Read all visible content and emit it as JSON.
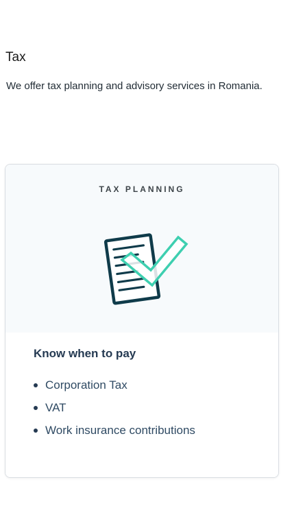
{
  "section": {
    "title": "Tax",
    "description": "We offer tax planning and advisory services in Romania."
  },
  "card": {
    "eyebrow": "TAX PLANNING",
    "illustration_icon": "document-checkmark-icon",
    "heading": "Know when to pay",
    "items": [
      {
        "label": "Corporation Tax"
      },
      {
        "label": "VAT"
      },
      {
        "label": "Work insurance contributions"
      }
    ]
  },
  "colors": {
    "accent_teal": "#3ecfb0",
    "dark_navy": "#0f3b4a",
    "heading_navy": "#253a52",
    "card_top_bg": "#f7fafc"
  }
}
